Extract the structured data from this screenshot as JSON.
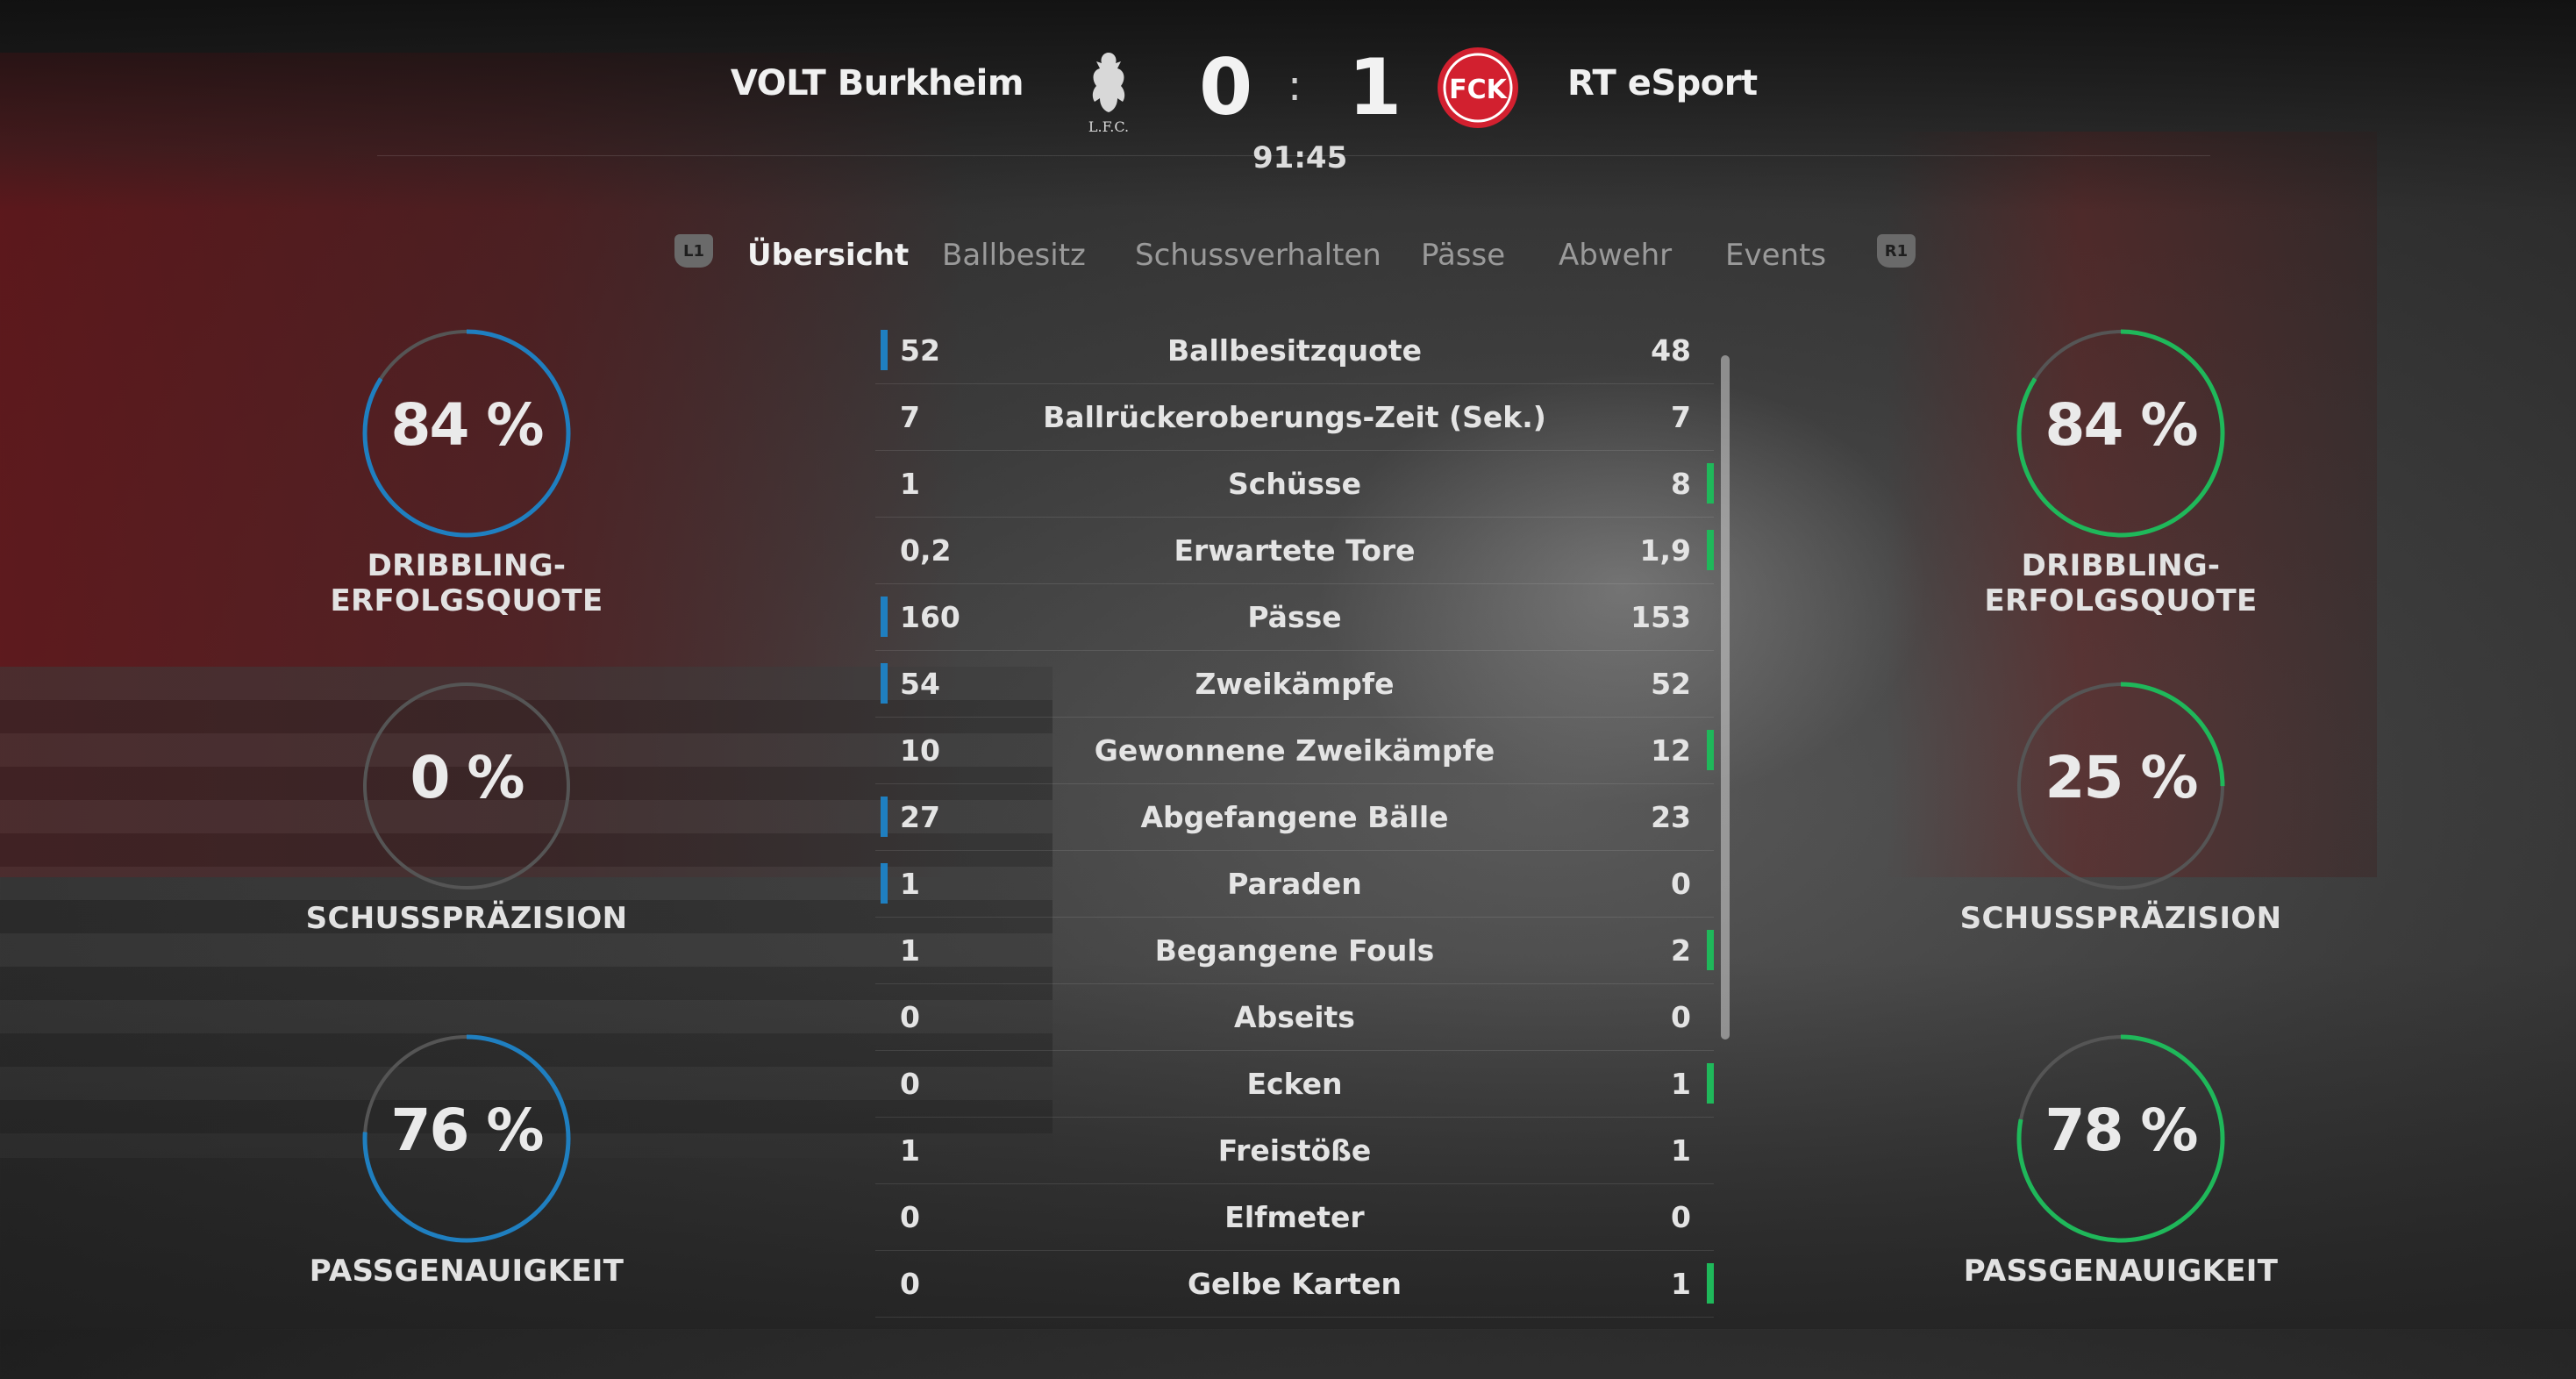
{
  "header": {
    "home_team": "VOLT Burkheim",
    "away_team": "RT eSport",
    "home_score": "0",
    "away_score": "1",
    "separator": ":",
    "clock": "91:45",
    "home_crest_text": "L.F.C.",
    "away_crest_text": "FCK"
  },
  "tabs": {
    "left_bumper": "L1",
    "right_bumper": "R1",
    "items": [
      "Übersicht",
      "Ballbesitz",
      "Schussverhalten",
      "Pässe",
      "Abwehr",
      "Events"
    ],
    "active": 0
  },
  "colors": {
    "home": "#1f7fc0",
    "away": "#1fb85a",
    "track": "#555555"
  },
  "home_gauges": [
    {
      "value": "84 %",
      "fraction": 0.84,
      "label": "DRIBBLING-ERFOLGSQUOTE"
    },
    {
      "value": "0 %",
      "fraction": 0.0,
      "label": "SCHUSSPRÄZISION"
    },
    {
      "value": "76 %",
      "fraction": 0.76,
      "label": "PASSGENAUIGKEIT"
    }
  ],
  "away_gauges": [
    {
      "value": "84 %",
      "fraction": 0.84,
      "label": "DRIBBLING-ERFOLGSQUOTE"
    },
    {
      "value": "25 %",
      "fraction": 0.25,
      "label": "SCHUSSPRÄZISION"
    },
    {
      "value": "78 %",
      "fraction": 0.78,
      "label": "PASSGENAUIGKEIT"
    }
  ],
  "stats": [
    {
      "name": "Ballbesitzquote",
      "home": "52",
      "away": "48",
      "leader": "home"
    },
    {
      "name": "Ballrückeroberungs-Zeit (Sek.)",
      "home": "7",
      "away": "7",
      "leader": "none"
    },
    {
      "name": "Schüsse",
      "home": "1",
      "away": "8",
      "leader": "away"
    },
    {
      "name": "Erwartete Tore",
      "home": "0,2",
      "away": "1,9",
      "leader": "away"
    },
    {
      "name": "Pässe",
      "home": "160",
      "away": "153",
      "leader": "home"
    },
    {
      "name": "Zweikämpfe",
      "home": "54",
      "away": "52",
      "leader": "home"
    },
    {
      "name": "Gewonnene Zweikämpfe",
      "home": "10",
      "away": "12",
      "leader": "away"
    },
    {
      "name": "Abgefangene Bälle",
      "home": "27",
      "away": "23",
      "leader": "home"
    },
    {
      "name": "Paraden",
      "home": "1",
      "away": "0",
      "leader": "home"
    },
    {
      "name": "Begangene Fouls",
      "home": "1",
      "away": "2",
      "leader": "away"
    },
    {
      "name": "Abseits",
      "home": "0",
      "away": "0",
      "leader": "none"
    },
    {
      "name": "Ecken",
      "home": "0",
      "away": "1",
      "leader": "away"
    },
    {
      "name": "Freistöße",
      "home": "1",
      "away": "1",
      "leader": "none"
    },
    {
      "name": "Elfmeter",
      "home": "0",
      "away": "0",
      "leader": "none"
    },
    {
      "name": "Gelbe Karten",
      "home": "0",
      "away": "1",
      "leader": "away"
    }
  ]
}
